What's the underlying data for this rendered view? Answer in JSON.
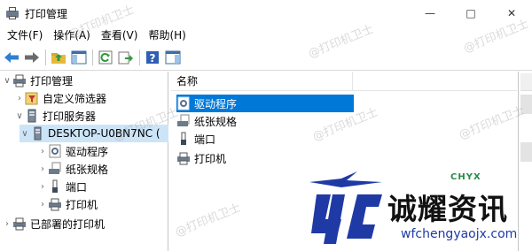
{
  "window": {
    "title": "打印管理"
  },
  "menu": [
    "文件(F)",
    "操作(A)",
    "查看(V)",
    "帮助(H)"
  ],
  "toolbar": [
    "back-icon",
    "forward-icon",
    "up-folder-icon",
    "show-hide-tree-icon",
    "refresh-icon",
    "export-list-icon",
    "help-icon",
    "action-pane-icon"
  ],
  "tree": [
    {
      "label": "打印管理",
      "icon": "print-management-icon",
      "chevron": "down",
      "depth": 0
    },
    {
      "label": "自定义筛选器",
      "icon": "filter-icon",
      "chevron": "right",
      "depth": 1
    },
    {
      "label": "打印服务器",
      "icon": "print-server-icon",
      "chevron": "down",
      "depth": 1
    },
    {
      "label": "DESKTOP-U0BN7NC (",
      "icon": "computer-icon",
      "chevron": "down",
      "depth": 2,
      "selected": true
    },
    {
      "label": "驱动程序",
      "icon": "driver-icon",
      "chevron": "right",
      "depth": 3
    },
    {
      "label": "纸张规格",
      "icon": "paper-icon",
      "chevron": "right",
      "depth": 3
    },
    {
      "label": "端口",
      "icon": "port-icon",
      "chevron": "right",
      "depth": 3
    },
    {
      "label": "打印机",
      "icon": "printer-icon",
      "chevron": "right",
      "depth": 3
    },
    {
      "label": "已部署的打印机",
      "icon": "printer-icon",
      "chevron": "right",
      "depth": 1
    }
  ],
  "list": {
    "header": "名称",
    "items": [
      {
        "label": "驱动程序",
        "icon": "driver-icon",
        "selected": true
      },
      {
        "label": "纸张规格",
        "icon": "paper-icon"
      },
      {
        "label": "端口",
        "icon": "port-icon"
      },
      {
        "label": "打印机",
        "icon": "printer-icon"
      }
    ]
  },
  "watermark": {
    "text": "@打印机卫士"
  },
  "logo": {
    "brand": "诚耀资讯",
    "url": "wfchengyaojx.com",
    "strip": "CHYX"
  }
}
